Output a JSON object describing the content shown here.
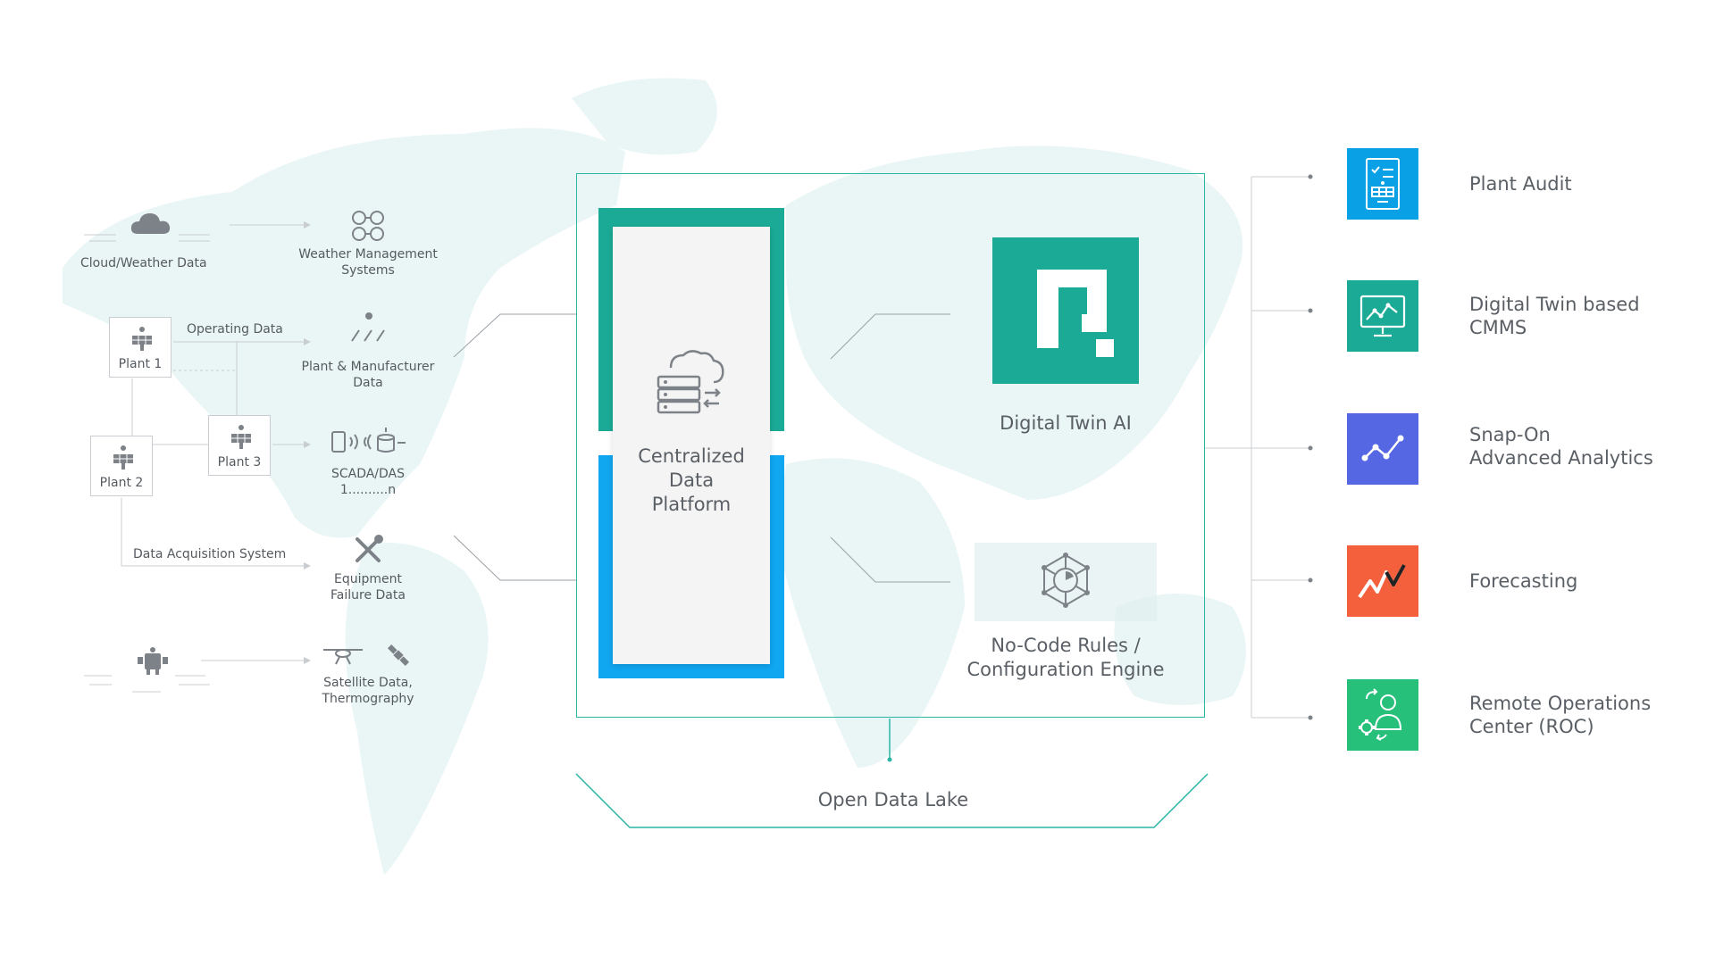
{
  "sources": {
    "cloud_weather": "Cloud/Weather Data",
    "operating_data": "Operating Data",
    "data_acquisition": "Data Acquisition System",
    "plant1": "Plant 1",
    "plant2": "Plant 2",
    "plant3": "Plant 3"
  },
  "data_types": {
    "weather_mgmt_1": "Weather Management",
    "weather_mgmt_2": "Systems",
    "plant_mfr_1": "Plant & Manufacturer",
    "plant_mfr_2": "Data",
    "scada_1": "SCADA/DAS",
    "scada_2": "1..........n",
    "equipment_1": "Equipment",
    "equipment_2": "Failure Data",
    "satellite_1": "Satellite Data,",
    "satellite_2": "Thermography"
  },
  "center": {
    "cdp_1": "Centralized",
    "cdp_2": "Data",
    "cdp_3": "Platform",
    "digital_twin": "Digital Twin AI",
    "rules_1": "No-Code Rules /",
    "rules_2": "Configuration Engine",
    "data_lake": "Open Data Lake"
  },
  "outputs": [
    {
      "line1": "Plant Audit",
      "line2": "",
      "color": "#0aa0e6",
      "icon": "audit-document-icon"
    },
    {
      "line1": "Digital Twin based",
      "line2": "CMMS",
      "color": "#1aaa95",
      "icon": "monitor-chart-icon"
    },
    {
      "line1": "Snap-On",
      "line2": "Advanced Analytics",
      "color": "#5567e2",
      "icon": "analytics-line-icon"
    },
    {
      "line1": "Forecasting",
      "line2": "",
      "color": "#f4603c",
      "icon": "forecast-zigzag-icon"
    },
    {
      "line1": "Remote Operations",
      "line2": "Center (ROC)",
      "color": "#27c07b",
      "icon": "operator-gear-icon"
    }
  ],
  "colors": {
    "teal": "#1aaa95",
    "blue": "#10a6f0",
    "map": "#eaf6f6",
    "line": "#c9ccd0"
  }
}
